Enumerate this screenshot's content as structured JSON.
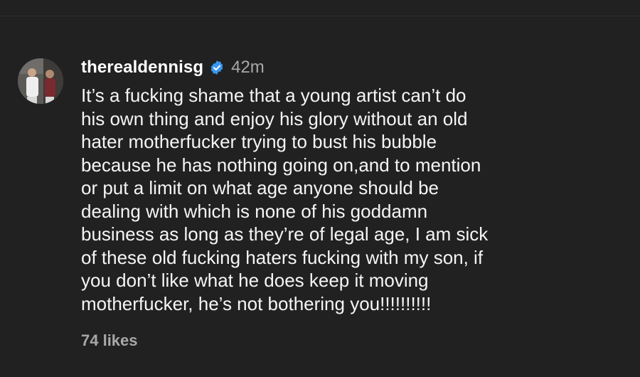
{
  "comment": {
    "username": "therealdennisg",
    "verified_icon": "verified-badge-icon",
    "verified_color": "#3897f0",
    "timestamp": "42m",
    "text": "It’s a fucking shame that a young artist can’t do\nhis own thing and enjoy his glory without an old\nhater motherfucker trying to bust his bubble\nbecause he has nothing going on,and to mention\nor put a limit on what age anyone should be\ndealing with which is none of his goddamn\nbusiness as long as they’re of legal age, I am sick\nof these old fucking haters fucking with my son, if\nyou don’t like what he does keep it moving\nmotherfucker, he’s not bothering you!!!!!!!!!!",
    "likes": "74 likes"
  },
  "colors": {
    "background": "#212122",
    "primary_text": "#f5f5f5",
    "secondary_text": "#a8a8a8"
  }
}
